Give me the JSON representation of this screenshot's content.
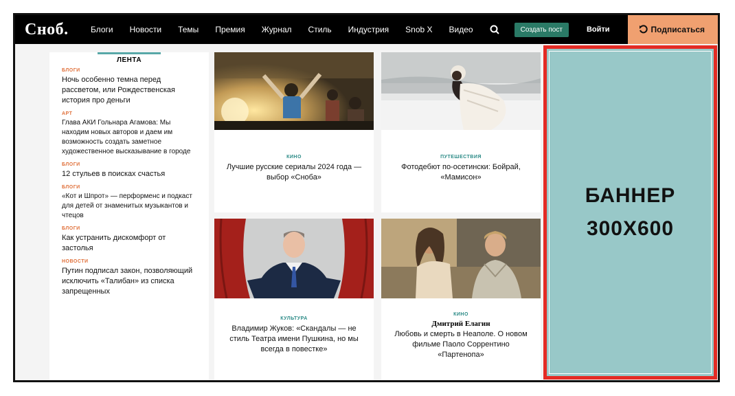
{
  "header": {
    "logo": "Сноб.",
    "nav": [
      "Блоги",
      "Новости",
      "Темы",
      "Премия",
      "Журнал",
      "Стиль",
      "Индустрия",
      "Snob X",
      "Видео"
    ],
    "search_icon": "search-icon",
    "create_post": "Создать пост",
    "login": "Войти",
    "subscribe_icon": "refresh-arrow-icon",
    "subscribe": "Подписаться"
  },
  "feed": {
    "title": "ЛЕНТА",
    "items": [
      {
        "category": "БЛОГИ",
        "title": "Ночь особенно темна перед рассветом, или Рождественская история про деньги"
      },
      {
        "category": "АРТ",
        "title": "Глава АКИ Гольнара Агамова: Мы находим новых авторов и даем им возможность создать заметное художественное высказывание в городе"
      },
      {
        "category": "БЛОГИ",
        "title": "12 стульев в поисках счастья"
      },
      {
        "category": "БЛОГИ",
        "title": "«Кот и Шпрот» — перформенс и подкаст для детей от знаменитых музыкантов и чтецов"
      },
      {
        "category": "БЛОГИ",
        "title": "Как устранить дискомфорт от застолья"
      },
      {
        "category": "НОВОСТИ",
        "title": "Путин подписал закон, позволяющий исключить «Талибан» из списка запрещенных"
      }
    ]
  },
  "cards": [
    {
      "category": "КИНО",
      "author": "",
      "title": "Лучшие русские сериалы 2024 года — выбор «Сноба»"
    },
    {
      "category": "ПУТЕШЕСТВИЯ",
      "author": "",
      "title": "Фотодебют по-осетински: Бойрай, «Мамисон»"
    },
    {
      "category": "КУЛЬТУРА",
      "author": "",
      "title": "Владимир Жуков: «Скандалы — не стиль Театра имени Пушкина, но мы всегда в повестке»"
    },
    {
      "category": "КИНО",
      "author": "Дмитрий Елагин",
      "title": "Любовь и смерть в Неаполе. О новом фильме Паоло Соррентино «Партенопа»"
    }
  ],
  "banner": {
    "line1": "БАННЕР",
    "line2": "300X600"
  },
  "colors": {
    "accent_teal": "#2a7a66",
    "subscribe_bg": "#f0a070",
    "banner_bg": "#98c8c8",
    "banner_border": "#e42b24",
    "feed_category": "#e0703a"
  }
}
